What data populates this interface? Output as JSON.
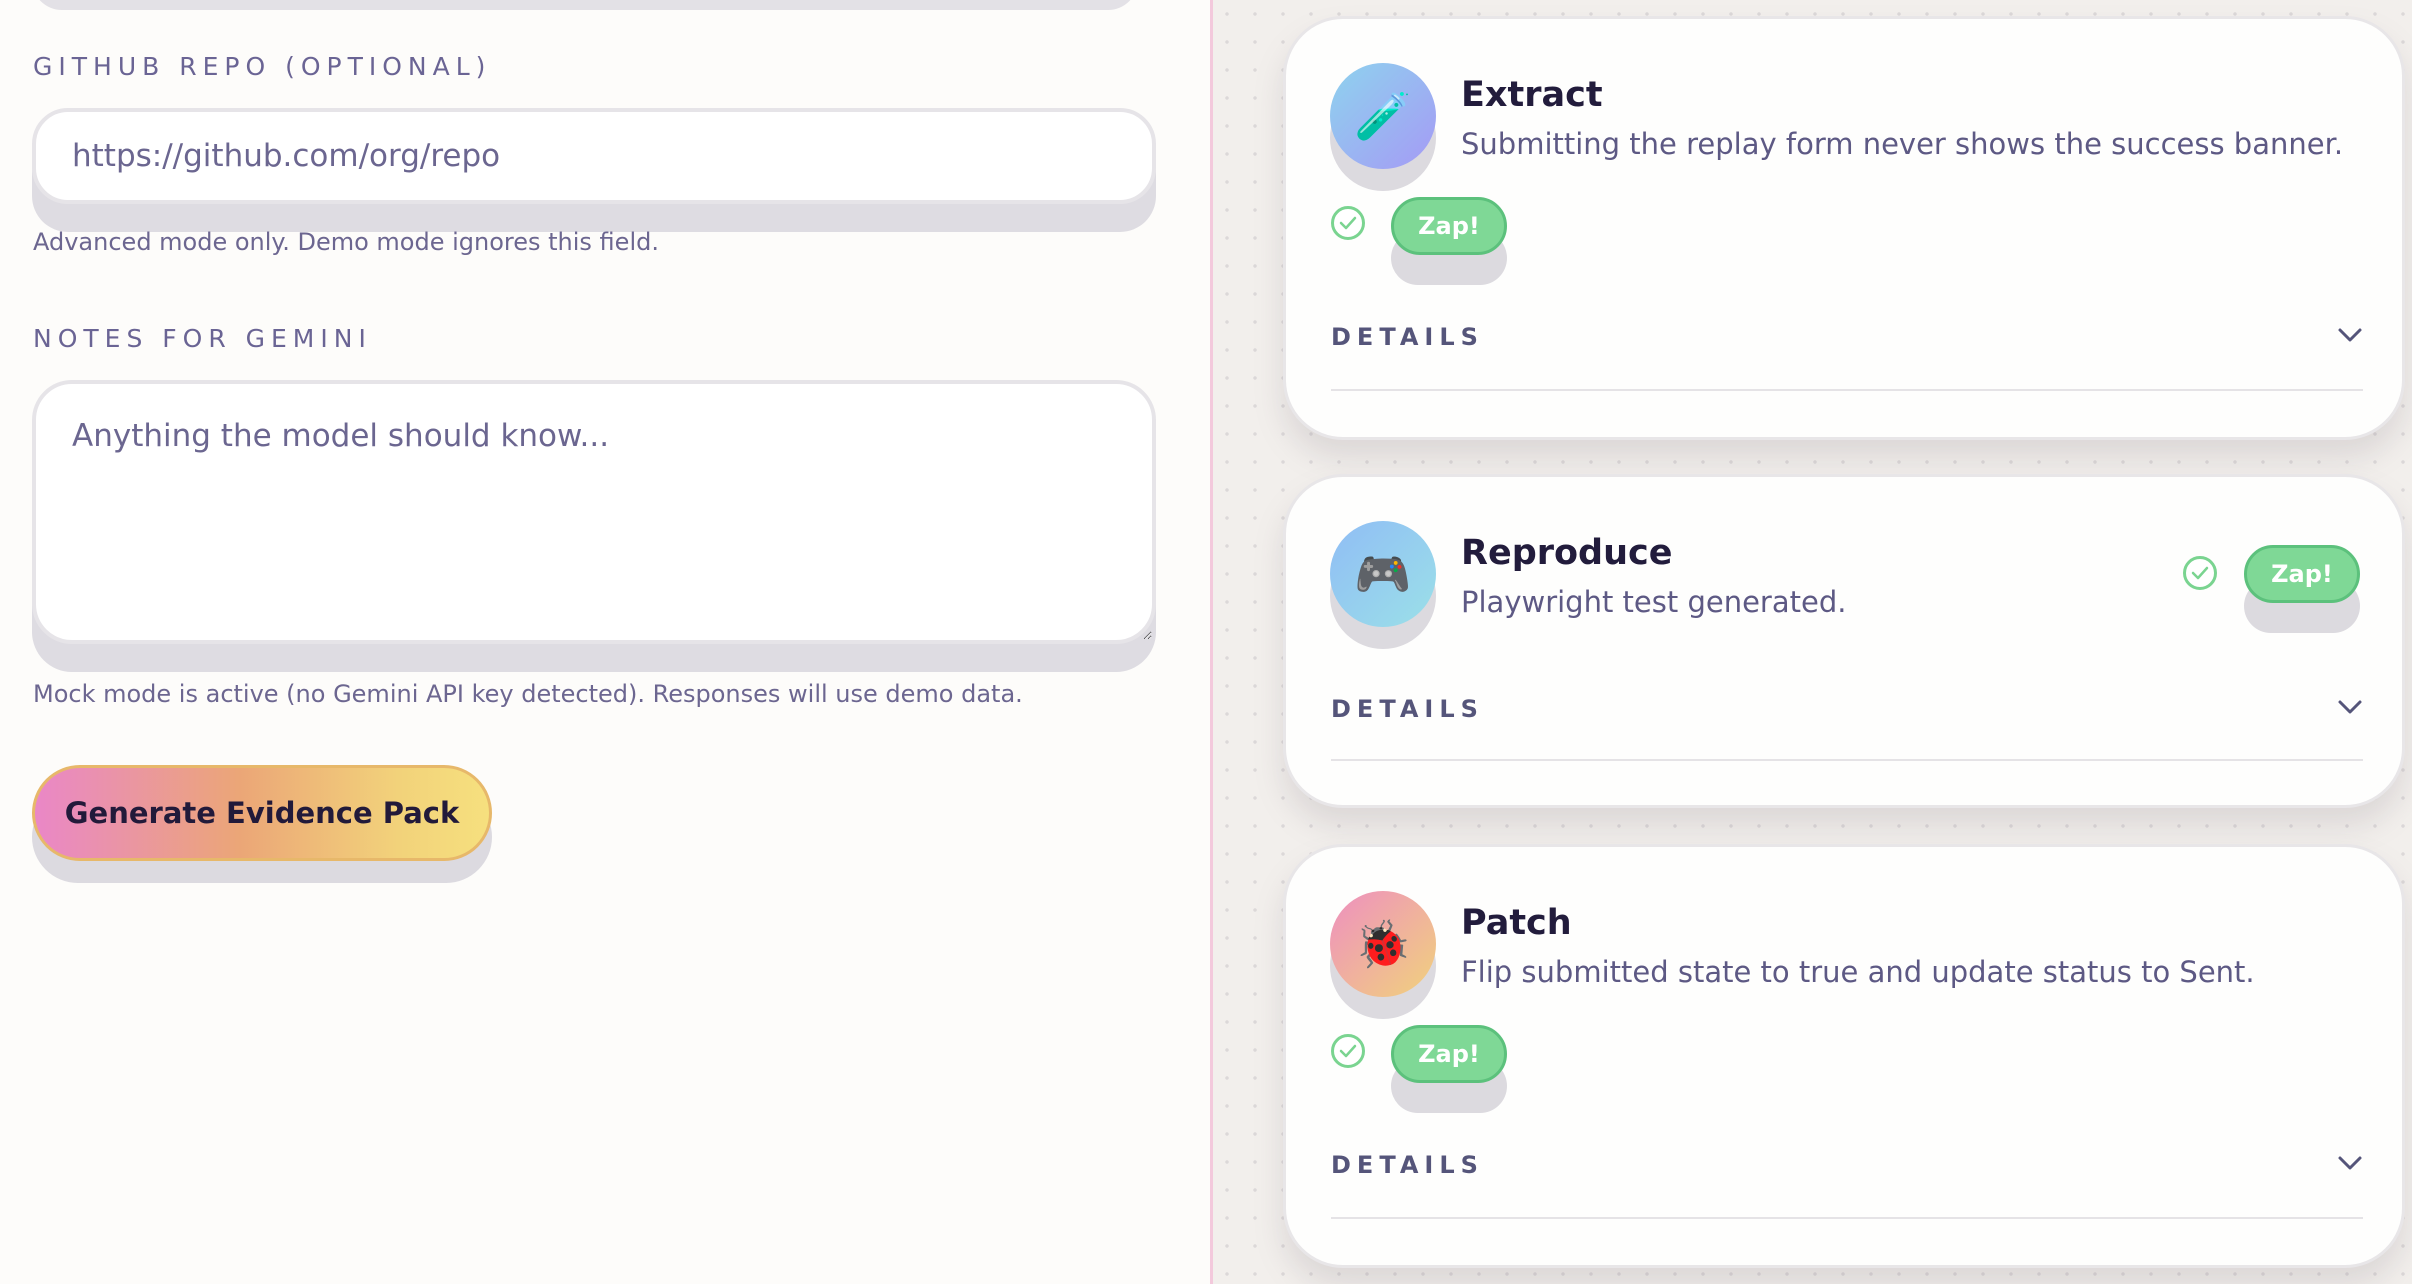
{
  "form": {
    "repo_label": "GITHUB REPO (OPTIONAL)",
    "repo_placeholder": "https://github.com/org/repo",
    "repo_hint": "Advanced mode only. Demo mode ignores this field.",
    "notes_label": "NOTES FOR GEMINI",
    "notes_placeholder": "Anything the model should know...",
    "notes_hint": "Mock mode is active (no Gemini API key detected). Responses will use demo data.",
    "generate_label": "Generate Evidence Pack"
  },
  "steps": [
    {
      "title": "Extract",
      "description": "Submitting the replay form never shows the success banner.",
      "icon": "test-tube-icon",
      "emoji": "🧪",
      "status": "done",
      "zap_label": "Zap!",
      "details_label": "DETAILS"
    },
    {
      "title": "Reproduce",
      "description": "Playwright test generated.",
      "icon": "gamepad-icon",
      "emoji": "🎮",
      "status": "done",
      "zap_label": "Zap!",
      "details_label": "DETAILS"
    },
    {
      "title": "Patch",
      "description": "Flip submitted state to true and update status to Sent.",
      "icon": "ladybug-icon",
      "emoji": "🐞",
      "status": "done",
      "zap_label": "Zap!",
      "details_label": "DETAILS"
    }
  ],
  "colors": {
    "accent_green": "#7fd896",
    "divider_pink": "#f3c9dc",
    "button_gradient_start": "#ea87c7",
    "button_gradient_end": "#f6e07e"
  }
}
